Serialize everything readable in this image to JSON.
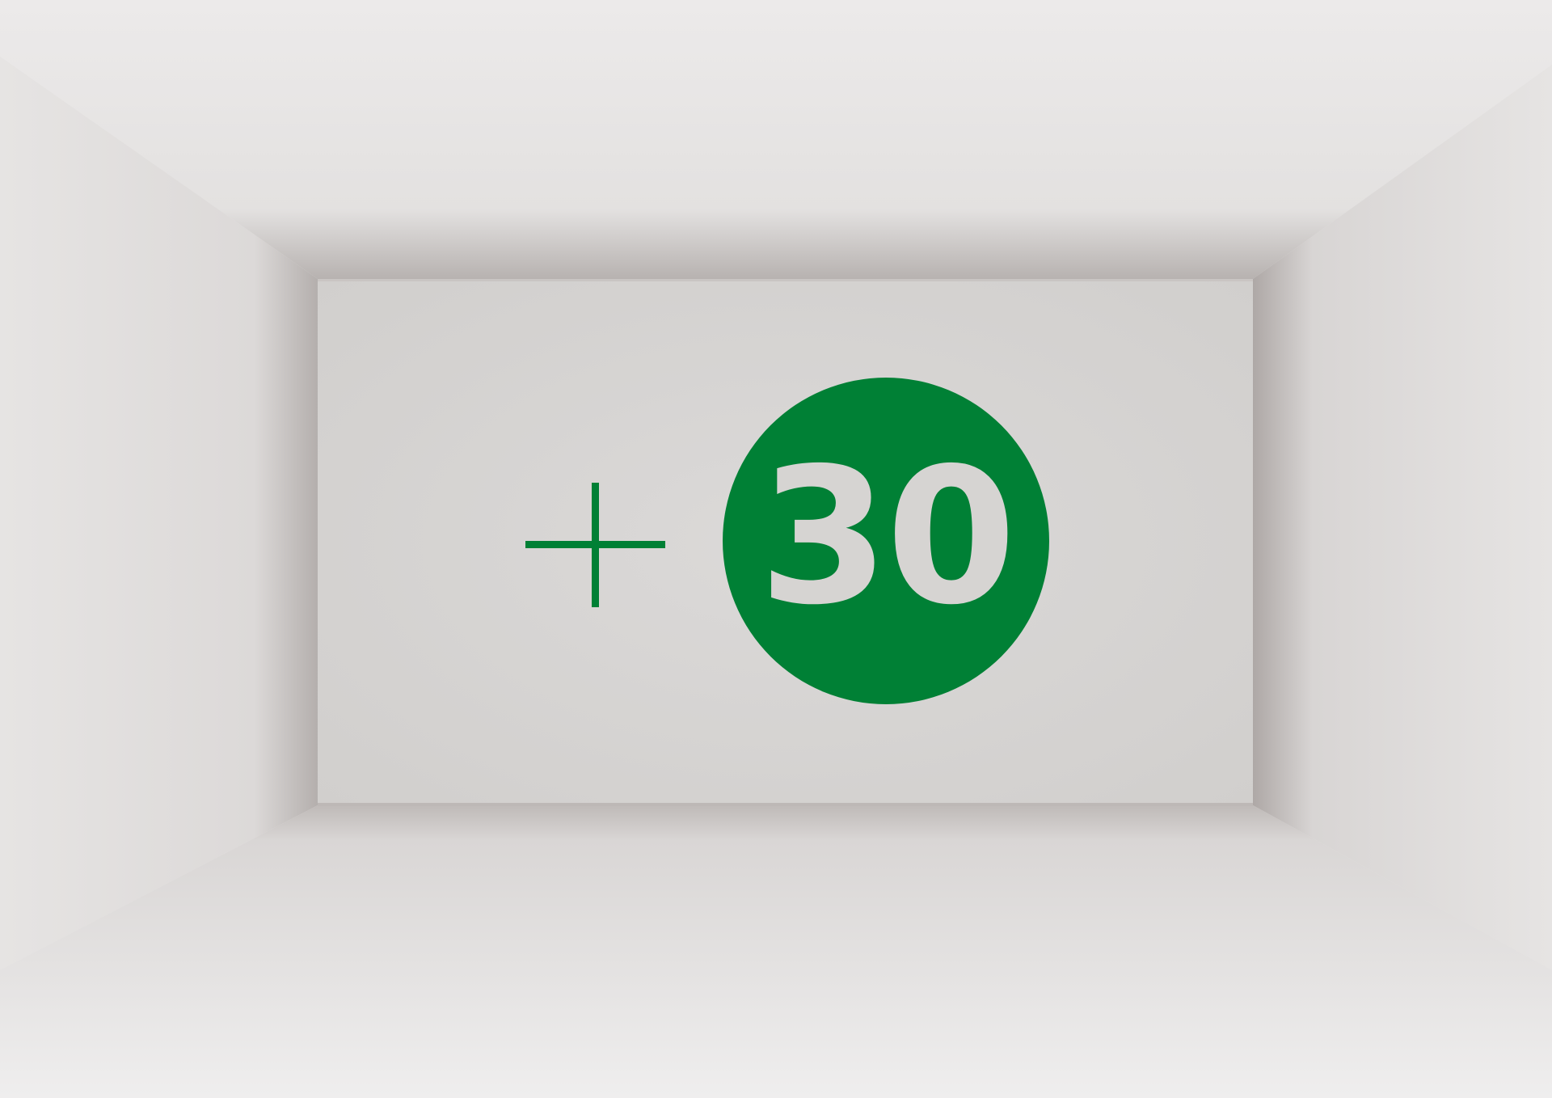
{
  "scene": {
    "description_type": "empty-room-box",
    "colors": {
      "back_wall": "#d6d4d2",
      "ceiling": "#e9e8e8",
      "floor": "#e2e0df",
      "side_wall": "#e4e2e1",
      "shadow": "#b9b4b2",
      "accent_green": "#008035"
    }
  },
  "sign": {
    "symbol": "+",
    "number": "30",
    "symbol_color": "#008035",
    "badge_color": "#008035",
    "number_color": "#d6d4d2"
  }
}
